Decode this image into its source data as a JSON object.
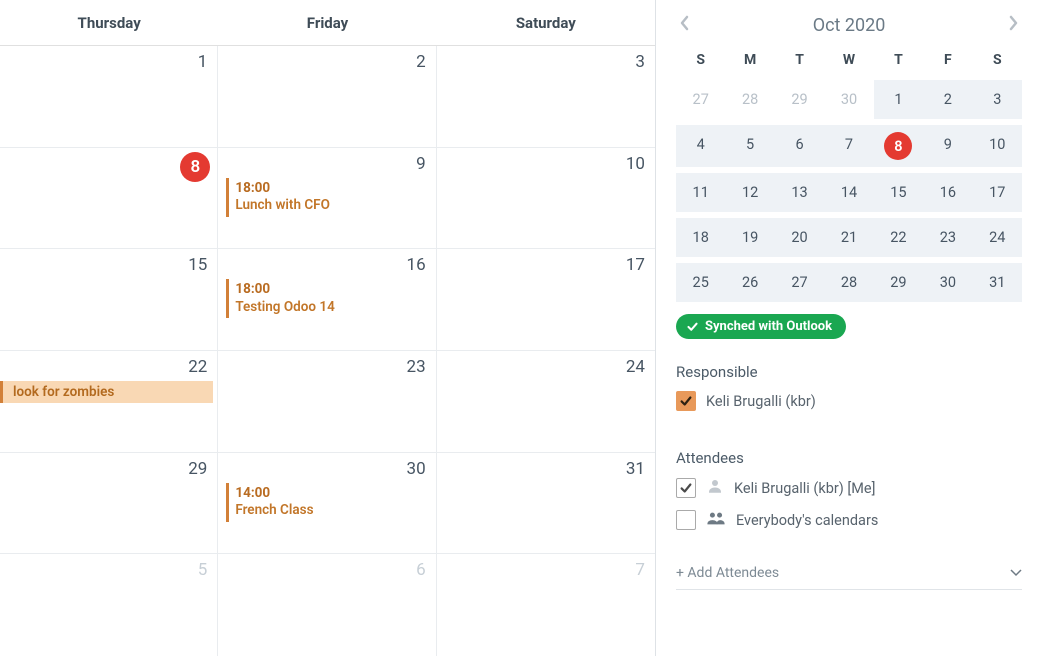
{
  "main": {
    "day_headers": [
      "Thursday",
      "Friday",
      "Saturday"
    ],
    "rows": [
      [
        {
          "date": "1"
        },
        {
          "date": "2"
        },
        {
          "date": "3"
        }
      ],
      [
        {
          "date": "8",
          "today": true
        },
        {
          "date": "9",
          "events": [
            {
              "time": "18:00",
              "title": "Lunch with CFO"
            }
          ]
        },
        {
          "date": "10"
        }
      ],
      [
        {
          "date": "15"
        },
        {
          "date": "16",
          "events": [
            {
              "time": "18:00",
              "title": "Testing Odoo 14"
            }
          ]
        },
        {
          "date": "17"
        }
      ],
      [
        {
          "date": "22",
          "allday": "look for zombies"
        },
        {
          "date": "23"
        },
        {
          "date": "24"
        }
      ],
      [
        {
          "date": "29"
        },
        {
          "date": "30",
          "events": [
            {
              "time": "14:00",
              "title": "French Class"
            }
          ]
        },
        {
          "date": "31"
        }
      ],
      [
        {
          "date": "5",
          "muted": true
        },
        {
          "date": "6",
          "muted": true
        },
        {
          "date": "7",
          "muted": true
        }
      ]
    ]
  },
  "sidebar": {
    "month_label": "Oct 2020",
    "weekdays": [
      "S",
      "M",
      "T",
      "W",
      "T",
      "F",
      "S"
    ],
    "mini_days": [
      {
        "d": "27",
        "prev": true
      },
      {
        "d": "28",
        "prev": true
      },
      {
        "d": "29",
        "prev": true
      },
      {
        "d": "30",
        "prev": true
      },
      {
        "d": "1",
        "inmonth": true
      },
      {
        "d": "2",
        "inmonth": true
      },
      {
        "d": "3",
        "inmonth": true
      },
      {
        "d": "4",
        "inmonth": true
      },
      {
        "d": "5",
        "inmonth": true
      },
      {
        "d": "6",
        "inmonth": true
      },
      {
        "d": "7",
        "inmonth": true
      },
      {
        "d": "8",
        "inmonth": true,
        "today": true
      },
      {
        "d": "9",
        "inmonth": true
      },
      {
        "d": "10",
        "inmonth": true
      },
      {
        "d": "11",
        "inmonth": true
      },
      {
        "d": "12",
        "inmonth": true
      },
      {
        "d": "13",
        "inmonth": true
      },
      {
        "d": "14",
        "inmonth": true
      },
      {
        "d": "15",
        "inmonth": true
      },
      {
        "d": "16",
        "inmonth": true
      },
      {
        "d": "17",
        "inmonth": true
      },
      {
        "d": "18",
        "inmonth": true
      },
      {
        "d": "19",
        "inmonth": true
      },
      {
        "d": "20",
        "inmonth": true
      },
      {
        "d": "21",
        "inmonth": true
      },
      {
        "d": "22",
        "inmonth": true
      },
      {
        "d": "23",
        "inmonth": true
      },
      {
        "d": "24",
        "inmonth": true
      },
      {
        "d": "25",
        "inmonth": true
      },
      {
        "d": "26",
        "inmonth": true
      },
      {
        "d": "27",
        "inmonth": true
      },
      {
        "d": "28",
        "inmonth": true
      },
      {
        "d": "29",
        "inmonth": true
      },
      {
        "d": "30",
        "inmonth": true
      },
      {
        "d": "31",
        "inmonth": true
      }
    ],
    "sync_label": "Synched with Outlook",
    "responsible_title": "Responsible",
    "responsible_name": "Keli Brugalli (kbr)",
    "attendees_title": "Attendees",
    "attendee_me": "Keli Brugalli (kbr) [Me]",
    "attendee_all": "Everybody's calendars",
    "add_attendees_placeholder": "+ Add Attendees"
  }
}
